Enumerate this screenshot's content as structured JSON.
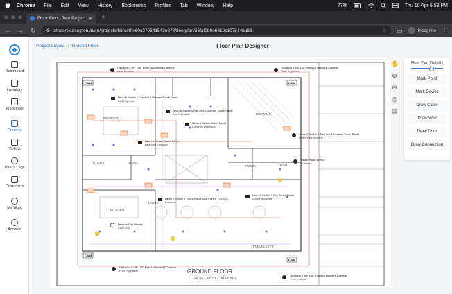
{
  "macos": {
    "app": "Chrome",
    "menu": [
      "File",
      "Edit",
      "View",
      "History",
      "Bookmarks",
      "Profiles",
      "Tab",
      "Window",
      "Help"
    ],
    "battery": "77%",
    "clock": "Thu 10 Apr 6:53 PM"
  },
  "browser": {
    "tab_title": "Floor Plan - Test Project | Ete...",
    "url": "etheonix.integron.ai/en/projects/66faef0e60c270341542e278/floorplan/66faf0b9e6819c107544ba88",
    "profile": "Incognito"
  },
  "sidebar": {
    "items": [
      {
        "label": "Dashboard",
        "icon": "grid-icon"
      },
      {
        "label": "Inventory",
        "icon": "box-icon"
      },
      {
        "label": "Workflows",
        "icon": "workflow-icon"
      },
      {
        "label": "Projects",
        "icon": "folder-icon"
      },
      {
        "label": "Tickets",
        "icon": "ticket-icon"
      },
      {
        "label": "User's Logs",
        "icon": "history-icon"
      },
      {
        "label": "Customers",
        "icon": "home-icon"
      },
      {
        "label": "My Work",
        "icon": "check-circle-icon"
      },
      {
        "label": "Account",
        "icon": "user-icon"
      }
    ],
    "active": "Projects"
  },
  "breadcrumb": {
    "project": "Project Layout",
    "floor": "Ground Floor"
  },
  "page_title": "Floor Plan Designer",
  "visibility_panel": {
    "title": "Floor Plan Visibility",
    "level": 0.65,
    "buttons": [
      "Mark Point",
      "Mark Device",
      "Draw Cable",
      "Draw Wall",
      "Draw Door",
      "Draw Connection"
    ]
  },
  "plan": {
    "floor_title": "GROUND FLOOR",
    "floor_subtitle": "FALSE CEILING DRAWING",
    "rooms": [
      "BEDROOM 1",
      "DRAWING",
      "KITCHEN",
      "LIVING",
      "POOJA",
      "FOYER",
      "UTILITY",
      "STORE",
      "T'NEVEL LEFT",
      "DINING"
    ],
    "cam_badge": "CAM",
    "devices": [
      {
        "title": "Hikvision 8 MP 180° PanoVu Network Camera",
        "sub": "Rear Leftside"
      },
      {
        "title": "Hikvision 8 MP 180° PanoVu Network Camera",
        "sub": "Rear Rightside"
      },
      {
        "title": "Neon 6 Switch 1 Fan and 1 Dimmer Touch Panel",
        "sub": "Bed Rightside"
      },
      {
        "title": "Neon 6 Switch 1 Fan and 1 Dimmer Touch Panel",
        "sub": "Bed Rightside"
      },
      {
        "title": "Neon 4 Switch Touch Panel",
        "sub": "Entrance Rightside"
      },
      {
        "title": "Axon 6 Switch 1 Fan and 1 Dimmer Touch Panel",
        "sub": "Entrance Rightside"
      },
      {
        "title": "Neon 4 Switch Touch Panel",
        "sub": "Bedroom Entrance"
      },
      {
        "title": "Fibaro Multi Sensor",
        "sub": "Entrance"
      },
      {
        "title": "Neon 6 Switch 1 Fan 1 Plug Touch Panel",
        "sub": "Entrance"
      },
      {
        "title": "Neon 8 Switch 1 Fan Touch Panel",
        "sub": "Dining Rightside"
      },
      {
        "title": "Heiman Gas Sensor",
        "sub": "Cook Top"
      },
      {
        "title": "Hikvision 8 MP 180° PanoVu Network Camera",
        "sub": "Front Rightside"
      },
      {
        "title": "Hikvision 8 MP 180° PanoVu Network Camera",
        "sub": "Front Leftside"
      }
    ]
  }
}
